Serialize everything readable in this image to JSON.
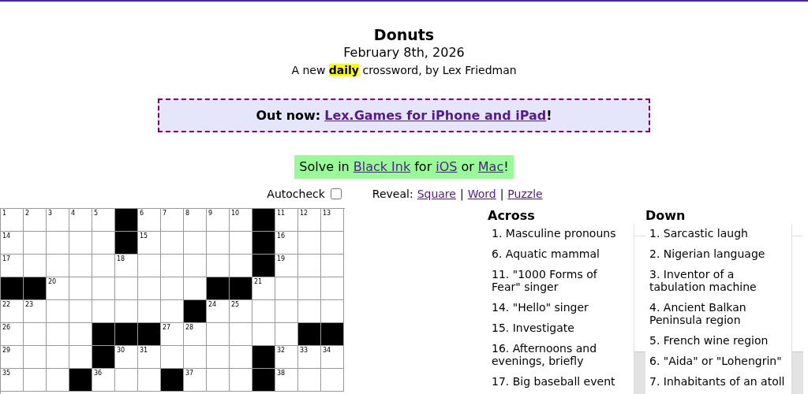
{
  "title": "Donuts",
  "date": "February 8th, 2026",
  "subtitle": "A new **daily** crossword, by Lex Friedman",
  "banner": {
    "label": "Out now:",
    "link": "Lex.Games for iPhone and iPad",
    "end": "!"
  },
  "solve": {
    "parts": [
      {
        "kind": "text",
        "text": "Solve in"
      },
      {
        "kind": "link",
        "text": "Black Ink"
      },
      {
        "kind": "text",
        "text": "for"
      },
      {
        "kind": "link",
        "text": "iOS"
      },
      {
        "kind": "text",
        "text": "or"
      },
      {
        "kind": "link",
        "text": "Mac"
      },
      {
        "kind": "punct",
        "text": "!"
      }
    ]
  },
  "autocheck": {
    "label": "Autocheck",
    "checked": false
  },
  "reveal": {
    "label": "Reveal:",
    "parts": [
      {
        "kind": "link",
        "text": "Square"
      },
      {
        "kind": "separator",
        "text": "|"
      },
      {
        "kind": "link",
        "text": "Word"
      },
      {
        "kind": "separator",
        "text": "|"
      },
      {
        "kind": "link",
        "text": "Puzzle"
      }
    ]
  },
  "grid": [
    [
      {
        "black": false,
        "number": "1"
      },
      {
        "black": false,
        "number": "2"
      },
      {
        "black": false,
        "number": "3"
      },
      {
        "black": false,
        "number": "4"
      },
      {
        "black": false,
        "number": "5"
      },
      {
        "black": true
      },
      {
        "black": false,
        "number": "6"
      },
      {
        "black": false,
        "number": "7"
      },
      {
        "black": false,
        "number": "8"
      },
      {
        "black": false,
        "number": "9"
      },
      {
        "black": false,
        "number": "10"
      },
      {
        "black": true
      },
      {
        "black": false,
        "number": "11"
      },
      {
        "black": false,
        "number": "12"
      },
      {
        "black": false,
        "number": "13"
      }
    ],
    [
      {
        "black": false,
        "number": "14"
      },
      {
        "black": false
      },
      {
        "black": false
      },
      {
        "black": false
      },
      {
        "black": false
      },
      {
        "black": true
      },
      {
        "black": false,
        "number": "15"
      },
      {
        "black": false
      },
      {
        "black": false
      },
      {
        "black": false
      },
      {
        "black": false
      },
      {
        "black": true
      },
      {
        "black": false,
        "number": "16"
      },
      {
        "black": false
      },
      {
        "black": false
      }
    ],
    [
      {
        "black": false,
        "number": "17"
      },
      {
        "black": false
      },
      {
        "black": false
      },
      {
        "black": false
      },
      {
        "black": false
      },
      {
        "black": false,
        "number": "18"
      },
      {
        "black": false
      },
      {
        "black": false
      },
      {
        "black": false
      },
      {
        "black": false
      },
      {
        "black": false
      },
      {
        "black": true
      },
      {
        "black": false,
        "number": "19"
      },
      {
        "black": false
      },
      {
        "black": false
      }
    ],
    [
      {
        "black": true
      },
      {
        "black": true
      },
      {
        "black": false,
        "number": "20"
      },
      {
        "black": false
      },
      {
        "black": false
      },
      {
        "black": false
      },
      {
        "black": false
      },
      {
        "black": false
      },
      {
        "black": false
      },
      {
        "black": true
      },
      {
        "black": true
      },
      {
        "black": false,
        "number": "21"
      },
      {
        "black": false
      },
      {
        "black": false
      },
      {
        "black": false
      }
    ],
    [
      {
        "black": false,
        "number": "22"
      },
      {
        "black": false,
        "number": "23"
      },
      {
        "black": false
      },
      {
        "black": false
      },
      {
        "black": false
      },
      {
        "black": false
      },
      {
        "black": false
      },
      {
        "black": false
      },
      {
        "black": true
      },
      {
        "black": false,
        "number": "24"
      },
      {
        "black": false,
        "number": "25"
      },
      {
        "black": false
      },
      {
        "black": false
      },
      {
        "black": false
      },
      {
        "black": false
      }
    ],
    [
      {
        "black": false,
        "number": "26"
      },
      {
        "black": false
      },
      {
        "black": false
      },
      {
        "black": false
      },
      {
        "black": true
      },
      {
        "black": true
      },
      {
        "black": true
      },
      {
        "black": false,
        "number": "27"
      },
      {
        "black": false,
        "number": "28"
      },
      {
        "black": false
      },
      {
        "black": false
      },
      {
        "black": false
      },
      {
        "black": false
      },
      {
        "black": true
      },
      {
        "black": true
      }
    ],
    [
      {
        "black": false,
        "number": "29"
      },
      {
        "black": false
      },
      {
        "black": false
      },
      {
        "black": false
      },
      {
        "black": true
      },
      {
        "black": false,
        "number": "30"
      },
      {
        "black": false,
        "number": "31"
      },
      {
        "black": false
      },
      {
        "black": false
      },
      {
        "black": false
      },
      {
        "black": false
      },
      {
        "black": true
      },
      {
        "black": false,
        "number": "32"
      },
      {
        "black": false,
        "number": "33"
      },
      {
        "black": false,
        "number": "34"
      }
    ],
    [
      {
        "black": false,
        "number": "35"
      },
      {
        "black": false
      },
      {
        "black": false
      },
      {
        "black": true
      },
      {
        "black": false,
        "number": "36"
      },
      {
        "black": false
      },
      {
        "black": false
      },
      {
        "black": true
      },
      {
        "black": false,
        "number": "37"
      },
      {
        "black": false
      },
      {
        "black": false
      },
      {
        "black": true
      },
      {
        "black": false,
        "number": "38"
      },
      {
        "black": false
      },
      {
        "black": false
      }
    ]
  ],
  "clues": [
    {
      "heading": "Across",
      "items": [
        "1. Masculine pronouns",
        "6. Aquatic mammal",
        "11. \"1000 Forms of Fear\" singer",
        "14. \"Hello\" singer",
        "15. Investigate",
        "16. Afternoons and evenings, briefly",
        "17. Big baseball event"
      ]
    },
    {
      "heading": "Down",
      "items": [
        "1. Sarcastic laugh",
        "2. Nigerian language",
        "3. Inventor of a tabulation machine",
        "4. Ancient Balkan Peninsula region",
        "5. French wine region",
        "6. \"Aida\" or \"Lohengrin\"",
        "7. Inhabitants of an atoll"
      ]
    }
  ]
}
